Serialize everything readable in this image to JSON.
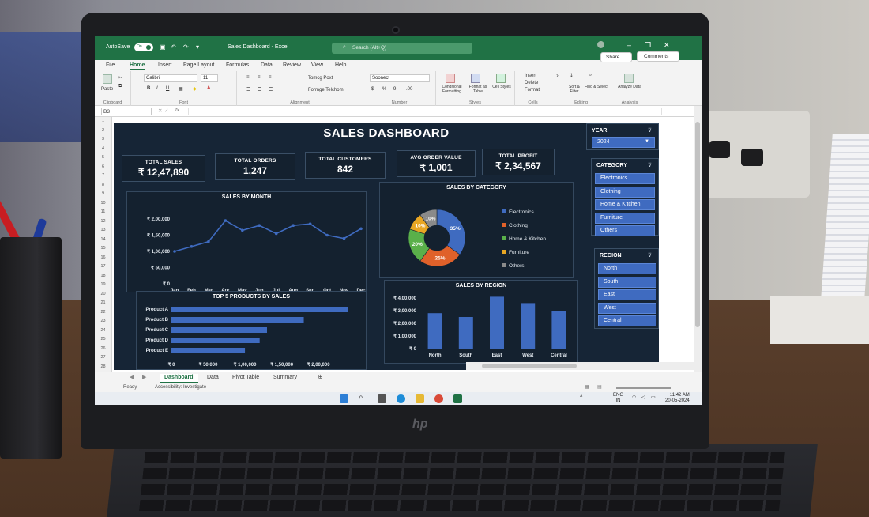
{
  "window": {
    "autosave_label": "AutoSave",
    "autosave_state": "On",
    "title": "Sales Dashboard - Excel",
    "search_placeholder": "Search (Alt+Q)",
    "share_label": "Share",
    "comments_label": "Comments",
    "accent_color": "#207245"
  },
  "menu": {
    "tabs": [
      "File",
      "Home",
      "Insert",
      "Page Layout",
      "Formulas",
      "Data",
      "Review",
      "View",
      "Help"
    ],
    "active": "Home"
  },
  "ribbon": {
    "clipboard_label": "Clipboard",
    "paste_label": "Paste",
    "font_label": "Font",
    "font_name": "Calibri",
    "font_size": "11",
    "alignment_label": "Alignment",
    "wrap_label": "Tomcg Poxt",
    "merge_label": "Formge Telchom",
    "number_label": "Number",
    "number_format": "Soonect",
    "styles_label": "Styles",
    "cond_format_label": "Conditional Formatting",
    "format_table_label": "Format as Table",
    "cell_styles_label": "Cell Styles",
    "cells_label": "Cells",
    "insert_label": "Insert",
    "delete_label": "Delete",
    "format_label": "Format",
    "editing_label": "Editing",
    "sort_label": "Sort & Filter",
    "find_label": "Find & Select",
    "analysis_label": "Analysis",
    "analyze_label": "Analyze Data"
  },
  "formula_bar": {
    "name_box": "B3",
    "fx_label": "fx"
  },
  "row_numbers": [
    "1",
    "2",
    "3",
    "4",
    "5",
    "6",
    "7",
    "8",
    "9",
    "10",
    "11",
    "12",
    "13",
    "14",
    "15",
    "16",
    "17",
    "18",
    "19",
    "20",
    "21",
    "22",
    "23",
    "24",
    "25",
    "26",
    "27",
    "28"
  ],
  "dashboard": {
    "title": "SALES DASHBOARD",
    "kpis": [
      {
        "label": "TOTAL SALES",
        "value": "₹ 12,47,890"
      },
      {
        "label": "TOTAL ORDERS",
        "value": "1,247"
      },
      {
        "label": "TOTAL CUSTOMERS",
        "value": "842"
      },
      {
        "label": "AVG ORDER VALUE",
        "value": "₹ 1,001"
      },
      {
        "label": "TOTAL PROFIT",
        "value": "₹ 2,34,567"
      }
    ],
    "monthly_title": "SALES BY MONTH",
    "category_title": "SALES BY CATEGORY",
    "products_title": "TOP 5 PRODUCTS BY SALES",
    "region_title": "SALES BY REGION",
    "chart_colors": {
      "series": "#3f6bc0",
      "pie": [
        "#3f6bc0",
        "#e0612a",
        "#5ab04a",
        "#e8a623",
        "#8a8a8a"
      ]
    }
  },
  "chart_data": [
    {
      "type": "line",
      "title": "SALES BY MONTH",
      "categories": [
        "Jan",
        "Feb",
        "Mar",
        "Apr",
        "May",
        "Jun",
        "Jul",
        "Aug",
        "Sep",
        "Oct",
        "Nov",
        "Dec"
      ],
      "values": [
        100000,
        115000,
        130000,
        195000,
        165000,
        180000,
        155000,
        180000,
        185000,
        150000,
        140000,
        170000
      ],
      "yticks": [
        "₹ 0",
        "₹ 50,000",
        "₹ 1,00,000",
        "₹ 1,50,000",
        "₹ 2,00,000"
      ],
      "ylim": [
        0,
        200000
      ]
    },
    {
      "type": "pie",
      "title": "SALES BY CATEGORY",
      "categories": [
        "Electronics",
        "Clothing",
        "Home & Kitchen",
        "Furniture",
        "Others"
      ],
      "values": [
        35,
        25,
        20,
        10,
        10
      ],
      "labels": [
        "35%",
        "25%",
        "20%",
        "10%",
        "10%"
      ]
    },
    {
      "type": "bar",
      "title": "TOP 5 PRODUCTS BY SALES",
      "orientation": "horizontal",
      "categories": [
        "Product A",
        "Product B",
        "Product C",
        "Product D",
        "Product E"
      ],
      "values": [
        240000,
        180000,
        130000,
        120000,
        100000
      ],
      "xticks": [
        "₹ 0",
        "₹ 50,000",
        "₹ 1,00,000",
        "₹ 1,50,000",
        "₹ 2,00,000"
      ],
      "xlim": [
        0,
        260000
      ]
    },
    {
      "type": "bar",
      "title": "SALES BY REGION",
      "categories": [
        "North",
        "South",
        "East",
        "West",
        "Central"
      ],
      "values": [
        280000,
        250000,
        410000,
        360000,
        300000
      ],
      "yticks": [
        "₹ 0",
        "₹ 1,00,000",
        "₹ 2,00,000",
        "₹ 3,00,000",
        "₹ 4,00,000"
      ],
      "ylim": [
        0,
        400000
      ]
    }
  ],
  "slicers": {
    "year": {
      "title": "YEAR",
      "selected": "2024"
    },
    "category": {
      "title": "CATEGORY",
      "items": [
        "Electronics",
        "Clothing",
        "Home & Kitchen",
        "Furniture",
        "Others"
      ]
    },
    "region": {
      "title": "REGION",
      "items": [
        "North",
        "South",
        "East",
        "West",
        "Central"
      ]
    }
  },
  "sheet_tabs": [
    "Dashboard",
    "Data",
    "Pivot Table",
    "Summary"
  ],
  "active_sheet": "Dashboard",
  "status": {
    "ready": "Ready",
    "accessibility": "Accessibility: Investigate"
  },
  "taskbar": {
    "lang": "ENG",
    "region": "IN",
    "time": "11:42 AM",
    "date": "20-05-2024"
  }
}
